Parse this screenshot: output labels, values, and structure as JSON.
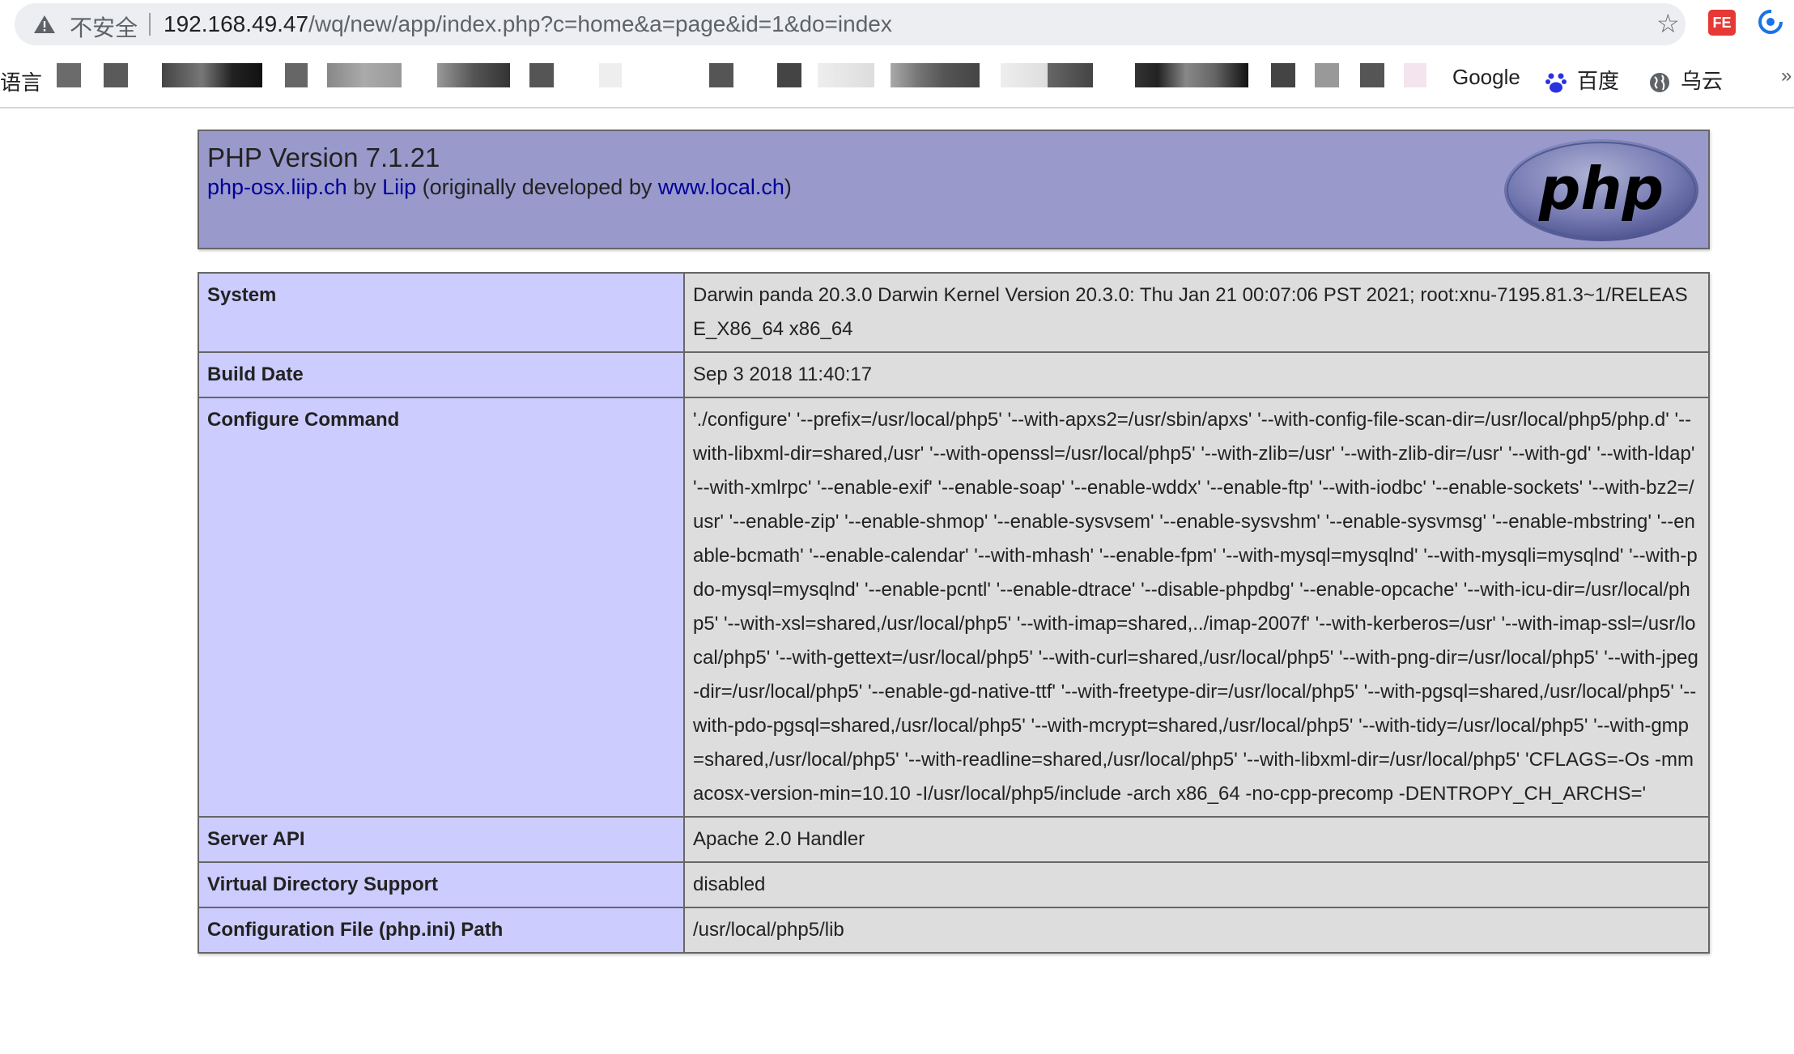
{
  "browser": {
    "security_label": "不安全",
    "url_host": "192.168.49.47",
    "url_path": "/wq/new/app/index.php?c=home&a=page&id=1&do=index",
    "bookmarks_lead": "语言",
    "bookmarks": [
      {
        "label": "Google",
        "icon": "google-icon"
      },
      {
        "label": "百度",
        "icon": "baidu-paw-icon"
      },
      {
        "label": "乌云",
        "icon": "globe-icon"
      }
    ],
    "more_label": "»",
    "extension_fe": "FE"
  },
  "php": {
    "version_title": "PHP Version 7.1.21",
    "distributor_link": "php-osx.liip.ch",
    "by_text": " by ",
    "liip_link": "Liip",
    "originally_text": " (originally developed by ",
    "local_link": "www.local.ch",
    "close_paren": ")",
    "logo_text": "php"
  },
  "info_rows": [
    {
      "key": "System",
      "value": "Darwin panda 20.3.0 Darwin Kernel Version 20.3.0: Thu Jan 21 00:07:06 PST 2021; root:xnu-7195.81.3~1/RELEASE_X86_64 x86_64"
    },
    {
      "key": "Build Date",
      "value": "Sep 3 2018 11:40:17"
    },
    {
      "key": "Configure Command",
      "value": "'./configure' '--prefix=/usr/local/php5' '--with-apxs2=/usr/sbin/apxs' '--with-config-file-scan-dir=/usr/local/php5/php.d' '--with-libxml-dir=shared,/usr' '--with-openssl=/usr/local/php5' '--with-zlib=/usr' '--with-zlib-dir=/usr' '--with-gd' '--with-ldap' '--with-xmlrpc' '--enable-exif' '--enable-soap' '--enable-wddx' '--enable-ftp' '--with-iodbc' '--enable-sockets' '--with-bz2=/usr' '--enable-zip' '--enable-shmop' '--enable-sysvsem' '--enable-sysvshm' '--enable-sysvmsg' '--enable-mbstring' '--enable-bcmath' '--enable-calendar' '--with-mhash' '--enable-fpm' '--with-mysql=mysqlnd' '--with-mysqli=mysqlnd' '--with-pdo-mysql=mysqlnd' '--enable-pcntl' '--enable-dtrace' '--disable-phpdbg' '--enable-opcache' '--with-icu-dir=/usr/local/php5' '--with-xsl=shared,/usr/local/php5' '--with-imap=shared,../imap-2007f' '--with-kerberos=/usr' '--with-imap-ssl=/usr/local/php5' '--with-gettext=/usr/local/php5' '--with-curl=shared,/usr/local/php5' '--with-png-dir=/usr/local/php5' '--with-jpeg-dir=/usr/local/php5' '--enable-gd-native-ttf' '--with-freetype-dir=/usr/local/php5' '--with-pgsql=shared,/usr/local/php5' '--with-pdo-pgsql=shared,/usr/local/php5' '--with-mcrypt=shared,/usr/local/php5' '--with-tidy=/usr/local/php5' '--with-gmp=shared,/usr/local/php5' '--with-readline=shared,/usr/local/php5' '--with-libxml-dir=/usr/local/php5' 'CFLAGS=-Os -mmacosx-version-min=10.10 -I/usr/local/php5/include -arch x86_64 -no-cpp-precomp -DENTROPY_CH_ARCHS='"
    },
    {
      "key": "Server API",
      "value": "Apache 2.0 Handler"
    },
    {
      "key": "Virtual Directory Support",
      "value": "disabled"
    },
    {
      "key": "Configuration File (php.ini) Path",
      "value": "/usr/local/php5/lib"
    }
  ],
  "colors": {
    "header_bg": "#9999cc",
    "key_cell_bg": "#ccccff",
    "value_cell_bg": "#dddddd",
    "link": "#000099"
  }
}
